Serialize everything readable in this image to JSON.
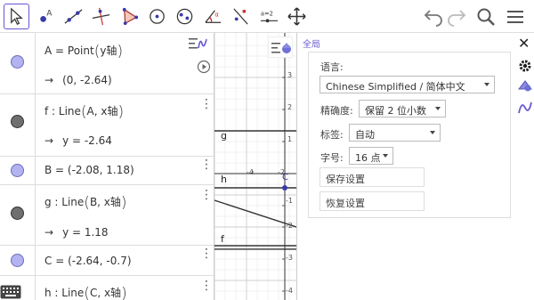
{
  "colors": {
    "accent": "#6557d2",
    "point_fill": "#b3b3f2",
    "line_fill": "#6f6f6f",
    "grid": "#d9d9d9"
  },
  "toolbar": {
    "tools": [
      {
        "name": "move-tool-icon"
      },
      {
        "name": "point-tool-icon"
      },
      {
        "name": "line-tool-icon"
      },
      {
        "name": "perpendicular-tool-icon"
      },
      {
        "name": "polygon-tool-icon"
      },
      {
        "name": "circle-tool-icon"
      },
      {
        "name": "ellipse-tool-icon"
      },
      {
        "name": "angle-tool-icon"
      },
      {
        "name": "reflect-tool-icon"
      },
      {
        "name": "slider-tool-icon",
        "text": "a=2"
      },
      {
        "name": "move-graphics-tool-icon"
      }
    ],
    "right": [
      "undo-icon",
      "redo-icon",
      "search-icon",
      "menu-icon"
    ]
  },
  "algebra": {
    "rows": [
      {
        "def": "A = Point",
        "def_arg": "y轴",
        "output": "(0, -2.64)",
        "kind": "point"
      },
      {
        "def": "f : Line",
        "def_arg": "A, x轴",
        "output": "y = -2.64",
        "kind": "line"
      },
      {
        "def": "B = (-2.08, 1.18)",
        "output": "",
        "kind": "point"
      },
      {
        "def": "g : Line",
        "def_arg": "B, x轴",
        "output": "y = 1.18",
        "kind": "line"
      },
      {
        "def": "C = (-2.64, -0.7)",
        "output": "",
        "kind": "point"
      },
      {
        "def": "h : Line",
        "def_arg": "C, x轴",
        "output": "",
        "kind": "line"
      }
    ],
    "arrow": "→",
    "menu_glyph": "⋮"
  },
  "graphics": {
    "x_ticks": [
      "-4",
      "-2"
    ],
    "y_ticks": [
      "3",
      "2",
      "1",
      "-1",
      "-2",
      "-3",
      "-4"
    ],
    "line_labels": {
      "g": "g",
      "h": "h",
      "f": "f",
      "c": "C"
    }
  },
  "settings": {
    "tab": "全局",
    "close": "✕",
    "language_label": "语言:",
    "language_value": "Chinese Simplified / 简体中文",
    "precision_label": "精确度:",
    "precision_value": "保留 2 位小数",
    "labeling_label": "标签:",
    "labeling_value": "自动",
    "fontsize_label": "字号:",
    "fontsize_value": "16 点",
    "save_button": "保存设置",
    "restore_button": "恢复设置"
  }
}
